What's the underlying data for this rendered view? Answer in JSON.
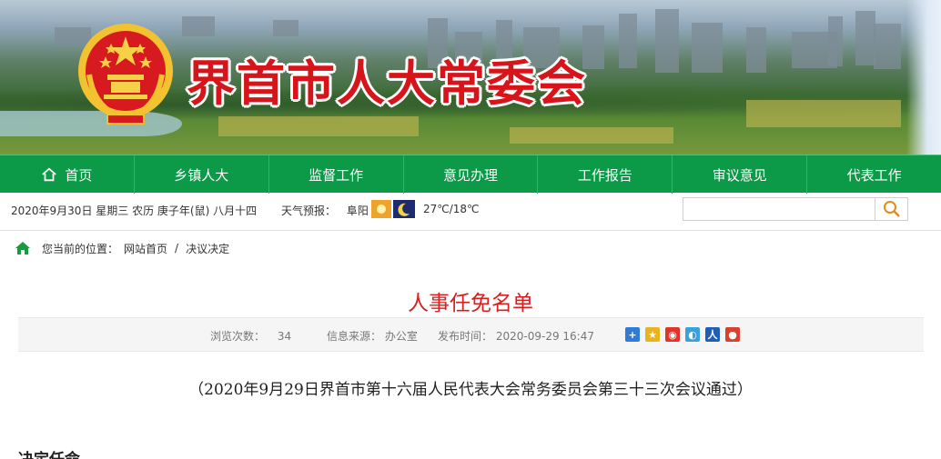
{
  "banner": {
    "title": "界首市人大常委会"
  },
  "nav": {
    "items": [
      {
        "label": "首页",
        "icon": "home-icon"
      },
      {
        "label": "乡镇人大"
      },
      {
        "label": "监督工作"
      },
      {
        "label": "意见办理"
      },
      {
        "label": "工作报告"
      },
      {
        "label": "审议意见"
      },
      {
        "label": "代表工作"
      }
    ]
  },
  "infobar": {
    "date": "2020年9月30日 星期三 农历 庚子年(鼠) 八月十四",
    "weather_label": "天气预报：",
    "city": "阜阳",
    "temperature": "27℃/18℃",
    "search_placeholder": ""
  },
  "breadcrumb": {
    "prefix": "您当前的位置：",
    "items": [
      "网站首页",
      "决议决定"
    ],
    "separator": "/"
  },
  "article": {
    "title": "人事任免名单",
    "views_label": "浏览次数：",
    "views": "34",
    "source_label": "信息来源：",
    "source": "办公室",
    "published_label": "发布时间：",
    "published": "2020-09-29 16:47",
    "subtitle": "（2020年9月29日界首市第十六届人民代表大会常务委员会第三十三次会议通过）",
    "section_heading": "决定任命"
  },
  "share_icons": [
    "share-plus-icon",
    "qzone-icon",
    "weibo-icon",
    "tencent-weibo-icon",
    "renren-icon",
    "kaixin-icon"
  ],
  "colors": {
    "nav_green": "#0d9a48",
    "title_red": "#d81e1e",
    "banner_red": "#d8141b"
  }
}
